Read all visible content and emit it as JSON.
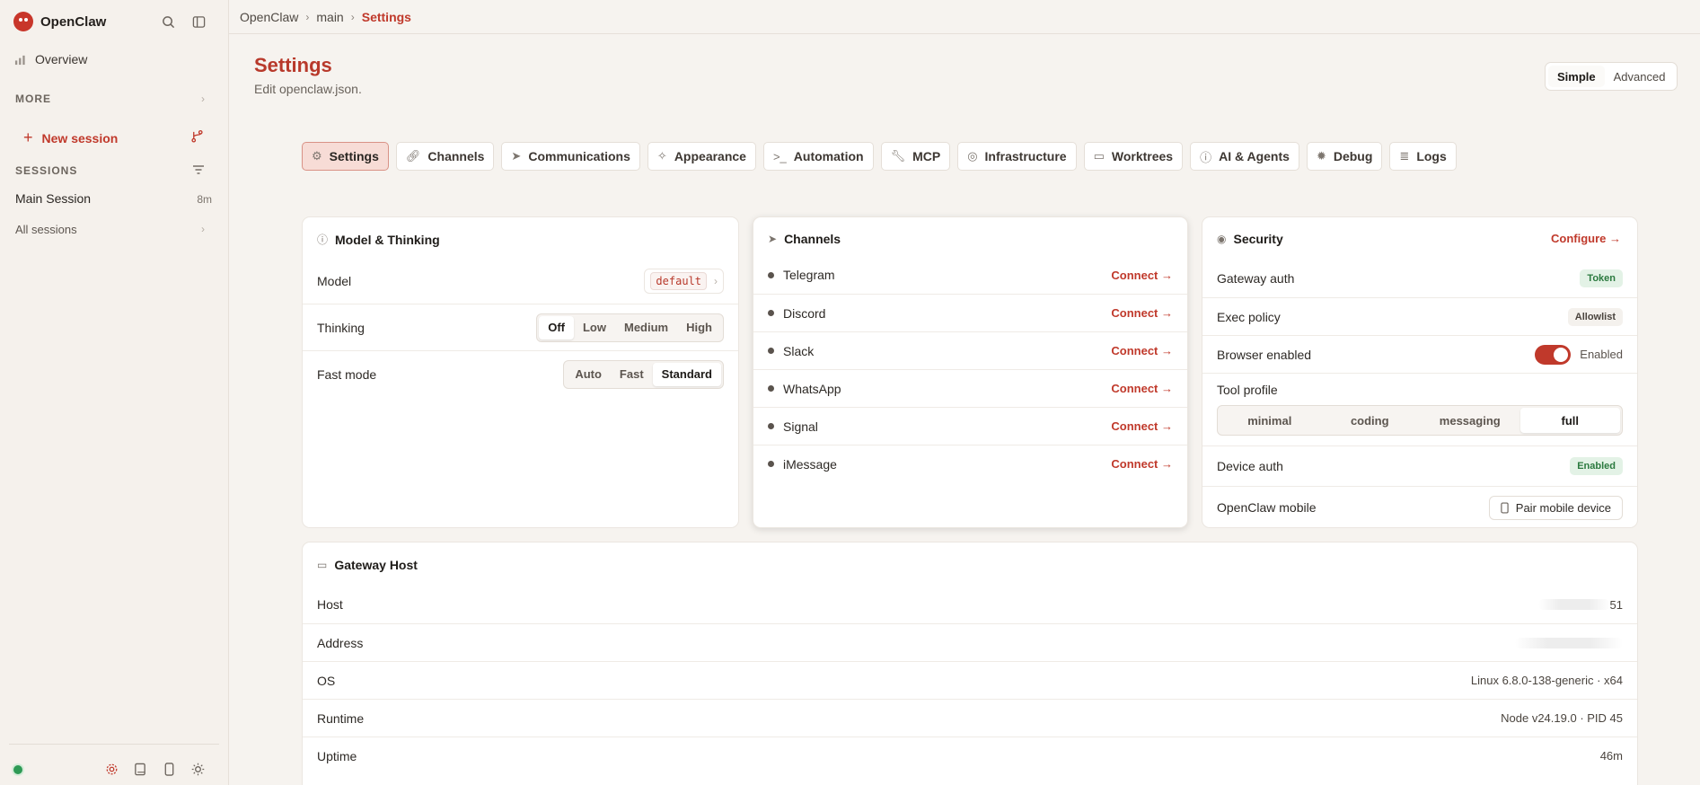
{
  "app": {
    "name": "OpenClaw"
  },
  "sidebar": {
    "overview_label": "Overview",
    "more_label": "MORE",
    "new_session_label": "New session",
    "sessions_label": "SESSIONS",
    "sessions": [
      {
        "name": "Main Session",
        "age": "8m"
      }
    ],
    "all_sessions_label": "All sessions",
    "status": "online"
  },
  "breadcrumb": [
    "OpenClaw",
    "main",
    "Settings"
  ],
  "header": {
    "title": "Settings",
    "subtitle": "Edit openclaw.json."
  },
  "mode": {
    "options": [
      "Simple",
      "Advanced"
    ],
    "selected": "Simple"
  },
  "tabs": [
    {
      "label": "Settings",
      "icon": "gear-icon",
      "active": true
    },
    {
      "label": "Channels",
      "icon": "link-icon"
    },
    {
      "label": "Communications",
      "icon": "send-icon"
    },
    {
      "label": "Appearance",
      "icon": "sparkle-icon"
    },
    {
      "label": "Automation",
      "icon": "terminal-icon"
    },
    {
      "label": "MCP",
      "icon": "wrench-icon"
    },
    {
      "label": "Infrastructure",
      "icon": "globe-icon"
    },
    {
      "label": "Worktrees",
      "icon": "folder-icon"
    },
    {
      "label": "AI & Agents",
      "icon": "brain-icon"
    },
    {
      "label": "Debug",
      "icon": "bug-icon"
    },
    {
      "label": "Logs",
      "icon": "scroll-icon"
    }
  ],
  "model_card": {
    "title": "Model & Thinking",
    "model_label": "Model",
    "model_value": "default",
    "thinking_label": "Thinking",
    "thinking_options": [
      "Off",
      "Low",
      "Medium",
      "High"
    ],
    "thinking_selected": "Off",
    "fast_label": "Fast mode",
    "fast_options": [
      "Auto",
      "Fast",
      "Standard"
    ],
    "fast_selected": "Standard"
  },
  "channels_card": {
    "title": "Channels",
    "connect_label": "Connect →",
    "items": [
      "Telegram",
      "Discord",
      "Slack",
      "WhatsApp",
      "Signal",
      "iMessage"
    ]
  },
  "security_card": {
    "title": "Security",
    "configure_label": "Configure →",
    "gateway_auth_label": "Gateway auth",
    "gateway_auth_value": "Token",
    "exec_policy_label": "Exec policy",
    "exec_policy_value": "Allowlist",
    "browser_label": "Browser enabled",
    "browser_value": "Enabled",
    "tool_profile_label": "Tool profile",
    "tool_profile_options": [
      "minimal",
      "coding",
      "messaging",
      "full"
    ],
    "tool_profile_selected": "full",
    "device_auth_label": "Device auth",
    "device_auth_value": "Enabled",
    "mobile_label": "OpenClaw mobile",
    "pair_label": "Pair mobile device"
  },
  "gateway_card": {
    "title": "Gateway Host",
    "rows": [
      {
        "label": "Host",
        "value": "51",
        "redacted": true
      },
      {
        "label": "Address",
        "value": "",
        "redacted": true
      },
      {
        "label": "OS",
        "value": "Linux 6.8.0-138-generic · x64"
      },
      {
        "label": "Runtime",
        "value": "Node v24.19.0 · PID 45"
      },
      {
        "label": "Uptime",
        "value": "46m"
      }
    ]
  },
  "colors": {
    "accent": "#c0392b",
    "success": "#2b7a3f",
    "background": "#f6f3ef"
  }
}
